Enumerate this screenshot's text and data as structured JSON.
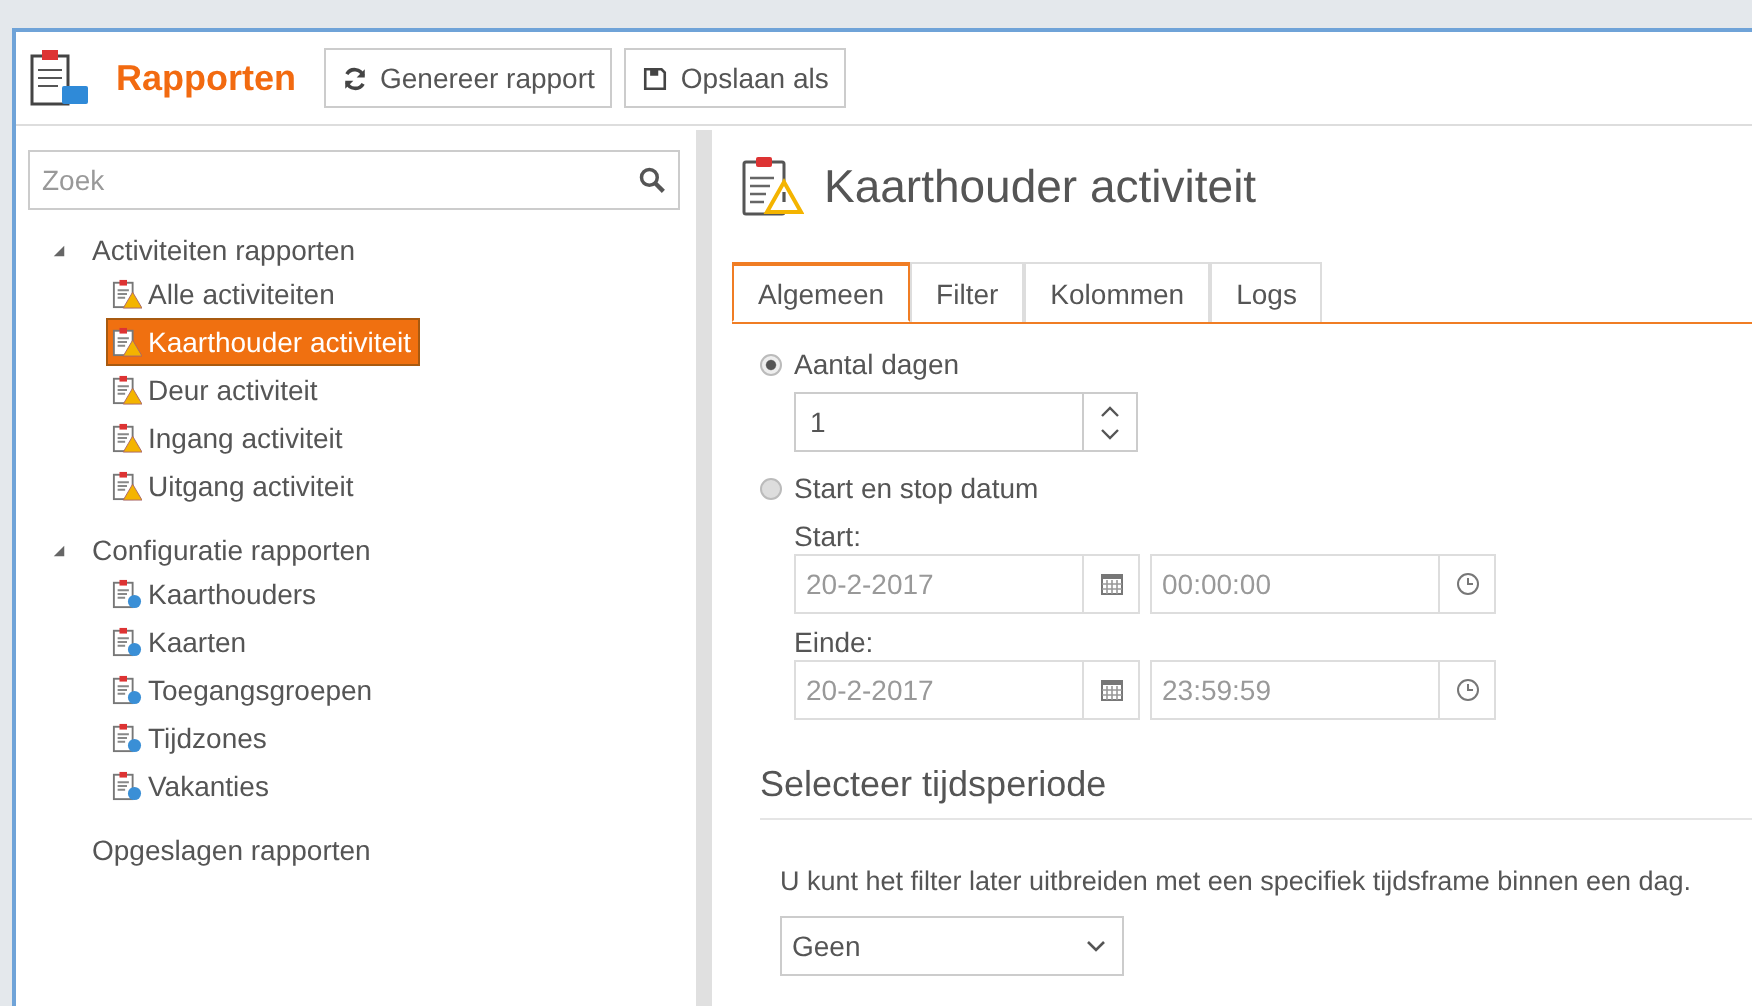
{
  "header": {
    "title": "Rapporten",
    "buttons": [
      {
        "label": "Genereer rapport",
        "kind": "refresh"
      },
      {
        "label": "Opslaan als",
        "kind": "save"
      }
    ]
  },
  "sidebar": {
    "search": {
      "placeholder": "Zoek"
    },
    "tree": [
      {
        "label": "Activiteiten rapporten",
        "expanded": true,
        "children": [
          {
            "label": "Alle activiteiten",
            "kind": "activity",
            "selected": false
          },
          {
            "label": "Kaarthouder activiteit",
            "kind": "activity",
            "selected": true
          },
          {
            "label": "Deur activiteit",
            "kind": "activity",
            "selected": false
          },
          {
            "label": "Ingang activiteit",
            "kind": "activity",
            "selected": false
          },
          {
            "label": "Uitgang activiteit",
            "kind": "activity",
            "selected": false
          }
        ]
      },
      {
        "label": "Configuratie rapporten",
        "expanded": true,
        "children": [
          {
            "label": "Kaarthouders",
            "kind": "config",
            "selected": false
          },
          {
            "label": "Kaarten",
            "kind": "config",
            "selected": false
          },
          {
            "label": "Toegangsgroepen",
            "kind": "config",
            "selected": false
          },
          {
            "label": "Tijdzones",
            "kind": "config",
            "selected": false
          },
          {
            "label": "Vakanties",
            "kind": "config",
            "selected": false
          }
        ]
      },
      {
        "label": "Opgeslagen rapporten",
        "expanded": false
      }
    ]
  },
  "report": {
    "title": "Kaarthouder activiteit",
    "tabs": [
      {
        "label": "Algemeen",
        "selected": true
      },
      {
        "label": "Filter",
        "selected": false
      },
      {
        "label": "Kolommen",
        "selected": false
      },
      {
        "label": "Logs",
        "selected": false
      }
    ],
    "options": [
      {
        "label": "Aantal dagen",
        "selected": true
      },
      {
        "label": "Start en stop datum",
        "selected": false
      }
    ],
    "days": "1",
    "ranges": [
      {
        "label": "Start:",
        "date": "20-2-2017",
        "time": "00:00:00"
      },
      {
        "label": "Einde:",
        "date": "20-2-2017",
        "time": "23:59:59"
      }
    ],
    "section_title": "Selecteer tijdsperiode",
    "hint": "U kunt het filter later uitbreiden met een specifiek tijdsframe binnen een dag.",
    "period": "Geen"
  }
}
